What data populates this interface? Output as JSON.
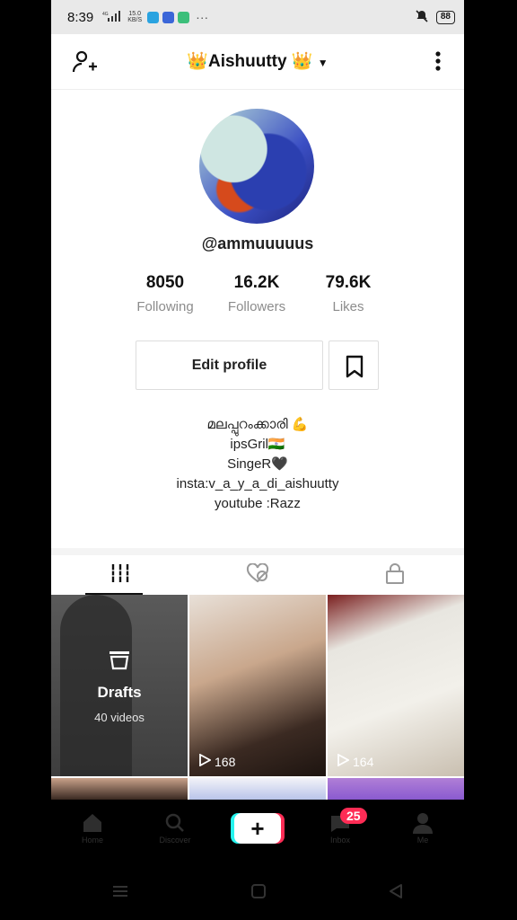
{
  "status_bar": {
    "time": "8:39",
    "network": "4G",
    "speed": "15.0",
    "speed_unit": "KB/S",
    "more": "···",
    "battery": "88"
  },
  "header": {
    "title": "👑Aishuutty 👑",
    "dropdown_icon": "caret-down-icon",
    "add_user_icon": "add-user-icon",
    "more_icon": "vertical-dots-icon"
  },
  "profile": {
    "handle": "@ammuuuuus",
    "stats": [
      {
        "value": "8050",
        "label": "Following"
      },
      {
        "value": "16.2K",
        "label": "Followers"
      },
      {
        "value": "79.6K",
        "label": "Likes"
      }
    ],
    "edit_label": "Edit profile",
    "bookmark_icon": "bookmark-icon",
    "bio": [
      "മലപ്പുറംക്കാരി 💪",
      "ipsGril🇮🇳",
      "SingeR🖤",
      "insta:v_a_y_a_di_aishuutty",
      "youtube :Razz"
    ]
  },
  "tabs": [
    {
      "icon": "grid-icon",
      "active": true
    },
    {
      "icon": "liked-hidden-icon",
      "active": false
    },
    {
      "icon": "lock-icon",
      "active": false
    }
  ],
  "videos": {
    "drafts": {
      "title": "Drafts",
      "count": "40 videos"
    },
    "items": [
      {
        "views": "168"
      },
      {
        "views": "164"
      }
    ]
  },
  "bottom_nav": {
    "items": [
      "Home",
      "Discover",
      "",
      "Inbox",
      "Me"
    ],
    "inbox_badge": "25"
  },
  "colors": {
    "accent_red": "#fe2c55",
    "accent_cyan": "#25f4ee",
    "text_secondary": "#8c8c8c"
  }
}
